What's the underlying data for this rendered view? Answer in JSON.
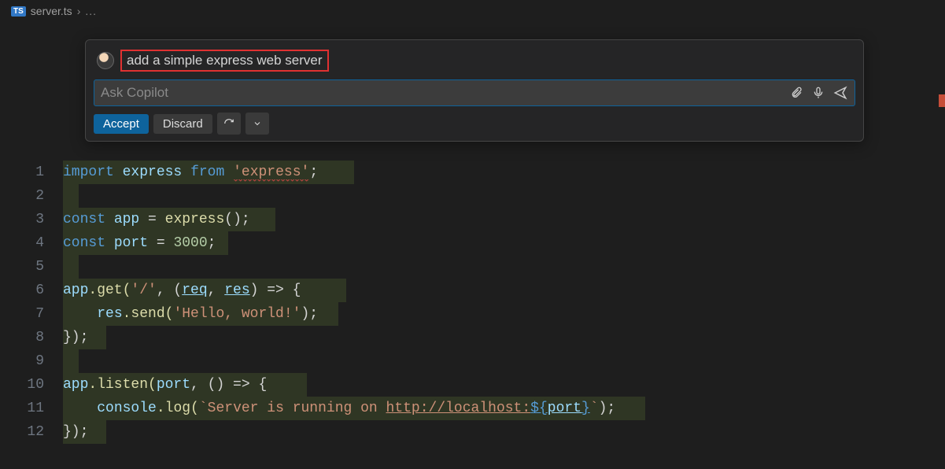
{
  "breadcrumb": {
    "icon_label": "TS",
    "filename": "server.ts",
    "suffix": "..."
  },
  "chat": {
    "prompt_text": "add a simple express web server",
    "input_placeholder": "Ask Copilot",
    "accept_label": "Accept",
    "discard_label": "Discard"
  },
  "code": {
    "lines": [
      1,
      2,
      3,
      4,
      5,
      6,
      7,
      8,
      9,
      10,
      11,
      12
    ],
    "l1": {
      "import": "import",
      "express": "express",
      "from": "from",
      "pkg": "'express'",
      ";": ";"
    },
    "l3": {
      "const": "const",
      "app": "app",
      "eq": " = ",
      "fn": "express",
      "paren": "();"
    },
    "l4": {
      "const": "const",
      "port": "port",
      "eq": " = ",
      "num": "3000",
      ";": ";"
    },
    "l6": {
      "app": "app",
      "get": ".get(",
      "path": "'/'",
      "comma": ", (",
      "req": "req",
      "c2": ", ",
      "res": "res",
      "arrow": ") => {"
    },
    "l7": {
      "indent": "    ",
      "res": "res",
      "send": ".send(",
      "msg": "'Hello, world!'",
      "end": ");"
    },
    "l8": {
      "close": "});"
    },
    "l10": {
      "app": "app",
      "listen": ".listen(",
      "port": "port",
      "comma": ", () => {"
    },
    "l11": {
      "indent": "    ",
      "console": "console",
      "log": ".log(",
      "tick1": "`",
      "msg": "Server is running on ",
      "url": "http://localhost:",
      "interp1": "${",
      "portv": "port",
      "interp2": "}",
      "tick2": "`",
      "end": ");"
    },
    "l12": {
      "close": "});"
    }
  }
}
